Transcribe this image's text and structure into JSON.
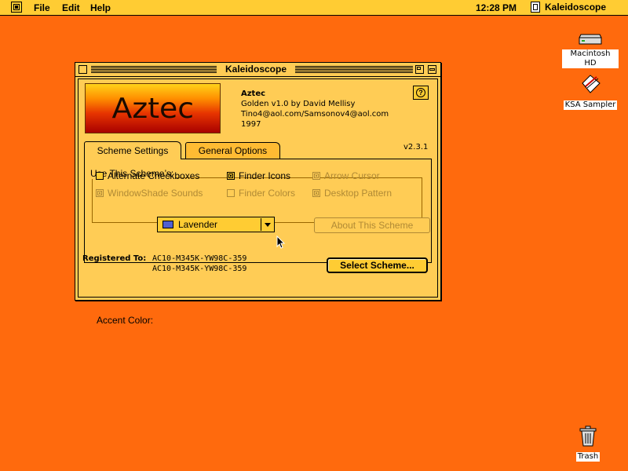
{
  "menubar": {
    "apple_icon": "apple-menu-icon",
    "menus": [
      "File",
      "Edit",
      "Help"
    ],
    "clock": "12:28 PM",
    "app_name": "Kaleidoscope"
  },
  "desktop": {
    "icons": [
      {
        "label": "Macintosh HD",
        "icon": "hard-drive-icon"
      },
      {
        "label": "KSA Sampler",
        "icon": "ksa-sampler-icon"
      },
      {
        "label": "Trash",
        "icon": "trash-icon"
      }
    ],
    "background_color": "#ff6a0d"
  },
  "window": {
    "title": "Kaleidoscope",
    "logo_text": "Aztec",
    "scheme": {
      "name": "Aztec",
      "line1": "Golden v1.0 by David Mellisy",
      "line2": "Tino4@aol.com/Samsonov4@aol.com",
      "line3": "1997"
    },
    "help_label": "?",
    "version": "v2.3.1",
    "tabs": [
      {
        "label": "Scheme Settings",
        "active": true
      },
      {
        "label": "General Options",
        "active": false
      }
    ],
    "group_label": "Use This Scheme’s:",
    "checkboxes": [
      {
        "label": "Alternate Checkboxes",
        "checked": false,
        "enabled": true
      },
      {
        "label": "Finder Icons",
        "checked": true,
        "enabled": true
      },
      {
        "label": "Arrow Cursor",
        "checked": true,
        "enabled": false
      },
      {
        "label": "WindowShade Sounds",
        "checked": true,
        "enabled": false
      },
      {
        "label": "Finder Colors",
        "checked": false,
        "enabled": false
      },
      {
        "label": "Desktop Pattern",
        "checked": true,
        "enabled": false
      }
    ],
    "accent_label": "Accent Color:",
    "accent_value": "Lavender",
    "accent_swatch_color": "#5060d0",
    "about_button": "About This Scheme",
    "registered_label": "Registered To:",
    "registered_codes": [
      "AC10-M345K-YW98C-359",
      "AC10-M345K-YW98C-359"
    ],
    "select_button": "Select Scheme..."
  }
}
